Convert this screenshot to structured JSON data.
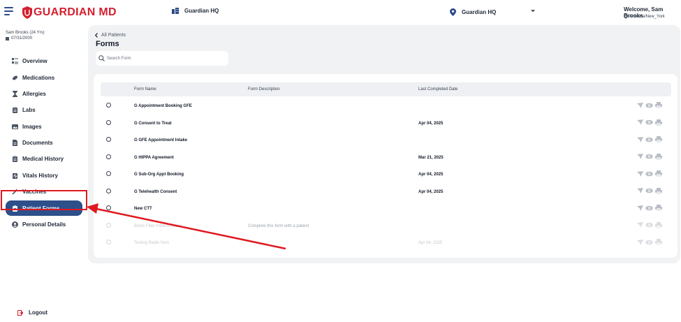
{
  "header": {
    "logo_text": "GUARDIAN MD",
    "org_name": "Guardian HQ",
    "location": "Guardian HQ",
    "welcome": "Welcome, Sam Brooks",
    "timezone": "America/New_York"
  },
  "patient": {
    "name": "Sam Brooks (24 Yrs)",
    "dob": "07/31/2000"
  },
  "nav": {
    "items": [
      {
        "label": "Overview",
        "icon": "overview-icon"
      },
      {
        "label": "Medications",
        "icon": "pill-icon"
      },
      {
        "label": "Allergies",
        "icon": "hourglass-icon"
      },
      {
        "label": "Labs",
        "icon": "clipboard-icon"
      },
      {
        "label": "Images",
        "icon": "image-icon"
      },
      {
        "label": "Documents",
        "icon": "document-icon"
      },
      {
        "label": "Medical History",
        "icon": "clipboard-icon"
      },
      {
        "label": "Vitals History",
        "icon": "vitals-icon"
      },
      {
        "label": "Vaccines",
        "icon": "syringe-icon"
      },
      {
        "label": "Patient Forms",
        "icon": "form-icon"
      },
      {
        "label": "Personal Details",
        "icon": "user-icon"
      }
    ],
    "active": "Patient Forms",
    "logout": "Logout"
  },
  "page": {
    "back_label": "All Patients",
    "title": "Forms",
    "search_placeholder": "Search Form"
  },
  "table": {
    "columns": [
      "Form Name",
      "Form Description",
      "Last Completed Date"
    ],
    "rows": [
      {
        "name": "G Appointment Booking GFE",
        "description": "",
        "date": "",
        "dim": false
      },
      {
        "name": "G Consent to Treat",
        "description": "",
        "date": "Apr 04, 2025",
        "dim": false
      },
      {
        "name": "G GFE Appointment Intake",
        "description": "",
        "date": "",
        "dim": false
      },
      {
        "name": "G HIPPA Agreement",
        "description": "",
        "date": "Mar 21, 2025",
        "dim": false
      },
      {
        "name": "G Sub-Org Appt Booking",
        "description": "",
        "date": "Apr 04, 2025",
        "dim": false
      },
      {
        "name": "G Telehealth Consent",
        "description": "",
        "date": "Apr 04, 2025",
        "dim": false
      },
      {
        "name": "New CTT",
        "description": "",
        "date": "",
        "dim": false
      },
      {
        "name": "Botox Filler Patient Intake",
        "description": "Complete this form with a patient",
        "date": "",
        "dim": true
      },
      {
        "name": "Testing Radio form",
        "description": "",
        "date": "Apr 04, 2025",
        "dim": true
      }
    ]
  },
  "colors": {
    "brand_red": "#d42030",
    "nav_active": "#2d4f8a",
    "annotation": "#e0181f"
  }
}
